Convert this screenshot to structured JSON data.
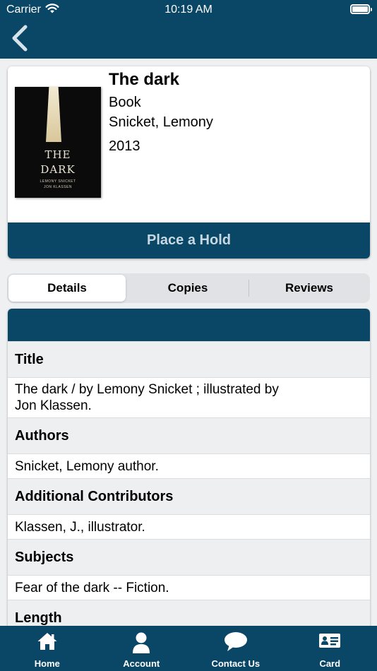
{
  "status_bar": {
    "carrier": "Carrier",
    "time": "10:19 AM"
  },
  "book": {
    "title": "The dark",
    "format": "Book",
    "author": "Snicket, Lemony",
    "year": "2013",
    "cover": {
      "title_line1": "THE",
      "title_line2": "DARK",
      "credit_line1": "LEMONY SNICKET",
      "credit_line2": "JON KLASSEN"
    }
  },
  "actions": {
    "place_hold": "Place a Hold"
  },
  "tabs": [
    "Details",
    "Copies",
    "Reviews"
  ],
  "details": {
    "title_label": "Title",
    "title_value_line1": "The dark / by Lemony Snicket ; illustrated by",
    "title_value_line2": "Jon Klassen.",
    "authors_label": "Authors",
    "authors_value": "Snicket, Lemony author.",
    "contributors_label": "Additional Contributors",
    "contributors_value": "Klassen, J., illustrator.",
    "subjects_label": "Subjects",
    "subjects_value": "Fear of the dark -- Fiction.",
    "length_label": "Length"
  },
  "tab_bar": {
    "items": [
      {
        "label": "Home",
        "icon": "home-icon"
      },
      {
        "label": "Account",
        "icon": "person-icon"
      },
      {
        "label": "Contact Us",
        "icon": "chat-bubble-icon"
      },
      {
        "label": "Card",
        "icon": "card-icon"
      }
    ]
  },
  "colors": {
    "primary": "#0a4767",
    "hold_text": "#c7d8e2",
    "background": "#eef0f2"
  }
}
